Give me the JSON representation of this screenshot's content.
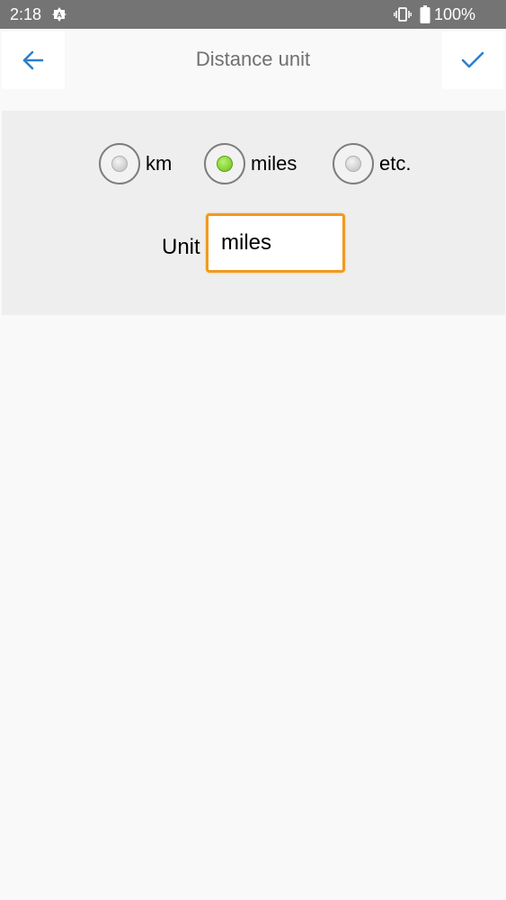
{
  "status_bar": {
    "time": "2:18",
    "battery": "100%",
    "icons": [
      "auto-icon",
      "vibrate-icon",
      "battery-icon"
    ]
  },
  "top_bar": {
    "title": "Distance unit",
    "back_icon": "arrow-left-icon",
    "confirm_icon": "checkmark-icon",
    "accent_color": "#2a7fd1"
  },
  "unit_options": [
    {
      "label": "km",
      "selected": false
    },
    {
      "label": "miles",
      "selected": true
    },
    {
      "label": "etc.",
      "selected": false
    }
  ],
  "unit_field": {
    "label": "Unit",
    "value": "miles"
  },
  "colors": {
    "status_bar": "#747474",
    "panel": "#eeeeee",
    "input_border": "#f09a1e",
    "radio_selected": "#6dc01b"
  }
}
